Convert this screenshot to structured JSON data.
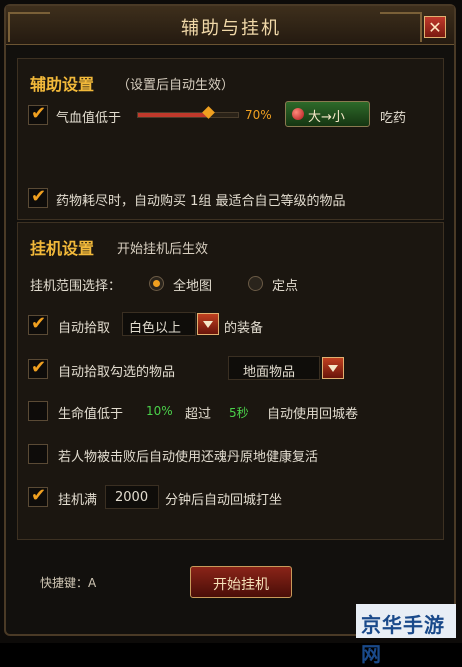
{
  "window": {
    "title": "辅助与挂机",
    "close_label": "✕"
  },
  "assist": {
    "heading": "辅助设置",
    "note": "（设置后自动生效）",
    "hp_check": {
      "checked": true,
      "label": "气血值低于",
      "percent_text": "70%",
      "percent": 70
    },
    "mode_button": "大→小",
    "after_label": "吃药",
    "buy_check": {
      "checked": true,
      "label": "药物耗尽时，自动购买 1组 最适合自己等级的物品"
    }
  },
  "idle": {
    "heading": "挂机设置",
    "note": "开始挂机后生效",
    "range_label": "挂机范围选择：",
    "range_options": [
      {
        "label": "全地图",
        "selected": true
      },
      {
        "label": "定点",
        "selected": false
      }
    ],
    "auto_pick": {
      "checked": true,
      "label": "自动拾取",
      "dropdown_value": "白色以上",
      "suffix": "的装备"
    },
    "auto_pick_selected": {
      "checked": true,
      "label": "自动拾取勾选的物品",
      "dropdown_value": "地面物品"
    },
    "hp_return": {
      "checked": false,
      "label_pre": "生命值低于",
      "percent": "10%",
      "label_mid": "超过",
      "seconds": "5秒",
      "label_post": "自动使用回城卷"
    },
    "revive": {
      "checked": false,
      "label": "若人物被击败后自动使用还魂丹原地健康复活"
    },
    "idle_full": {
      "checked": true,
      "label_pre": "挂机满",
      "minutes": "2000",
      "label_post": "分钟后自动回城打坐"
    }
  },
  "footer": {
    "hotkey_label": "快捷键：A",
    "start_button": "开始挂机"
  },
  "watermark": {
    "text": "京华手游网"
  },
  "colors": {
    "accent": "#f2b93a",
    "check": "#f0a020",
    "green_value": "#4ad04a",
    "button_red": "#8a2418"
  }
}
